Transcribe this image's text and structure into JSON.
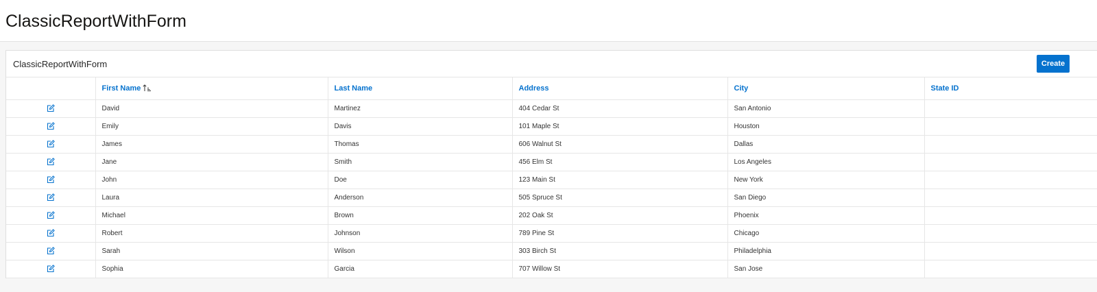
{
  "page": {
    "title": "ClassicReportWithForm"
  },
  "region": {
    "title": "ClassicReportWithForm",
    "create_label": "Create",
    "accent_color": "#0572ce"
  },
  "report": {
    "columns": [
      {
        "key": "edit",
        "label": ""
      },
      {
        "key": "first_name",
        "label": "First Name",
        "sorted": "ascending"
      },
      {
        "key": "last_name",
        "label": "Last Name"
      },
      {
        "key": "address",
        "label": "Address"
      },
      {
        "key": "city",
        "label": "City"
      },
      {
        "key": "state_id",
        "label": "State ID"
      }
    ],
    "rows": [
      {
        "first_name": "David",
        "last_name": "Martinez",
        "address": "404 Cedar St",
        "city": "San Antonio",
        "state_id": ""
      },
      {
        "first_name": "Emily",
        "last_name": "Davis",
        "address": "101 Maple St",
        "city": "Houston",
        "state_id": ""
      },
      {
        "first_name": "James",
        "last_name": "Thomas",
        "address": "606 Walnut St",
        "city": "Dallas",
        "state_id": ""
      },
      {
        "first_name": "Jane",
        "last_name": "Smith",
        "address": "456 Elm St",
        "city": "Los Angeles",
        "state_id": ""
      },
      {
        "first_name": "John",
        "last_name": "Doe",
        "address": "123 Main St",
        "city": "New York",
        "state_id": ""
      },
      {
        "first_name": "Laura",
        "last_name": "Anderson",
        "address": "505 Spruce St",
        "city": "San Diego",
        "state_id": ""
      },
      {
        "first_name": "Michael",
        "last_name": "Brown",
        "address": "202 Oak St",
        "city": "Phoenix",
        "state_id": ""
      },
      {
        "first_name": "Robert",
        "last_name": "Johnson",
        "address": "789 Pine St",
        "city": "Chicago",
        "state_id": ""
      },
      {
        "first_name": "Sarah",
        "last_name": "Wilson",
        "address": "303 Birch St",
        "city": "Philadelphia",
        "state_id": ""
      },
      {
        "first_name": "Sophia",
        "last_name": "Garcia",
        "address": "707 Willow St",
        "city": "San Jose",
        "state_id": ""
      }
    ],
    "edit_icon": "edit-icon",
    "sort_icon": "sort-ascending-icon"
  }
}
